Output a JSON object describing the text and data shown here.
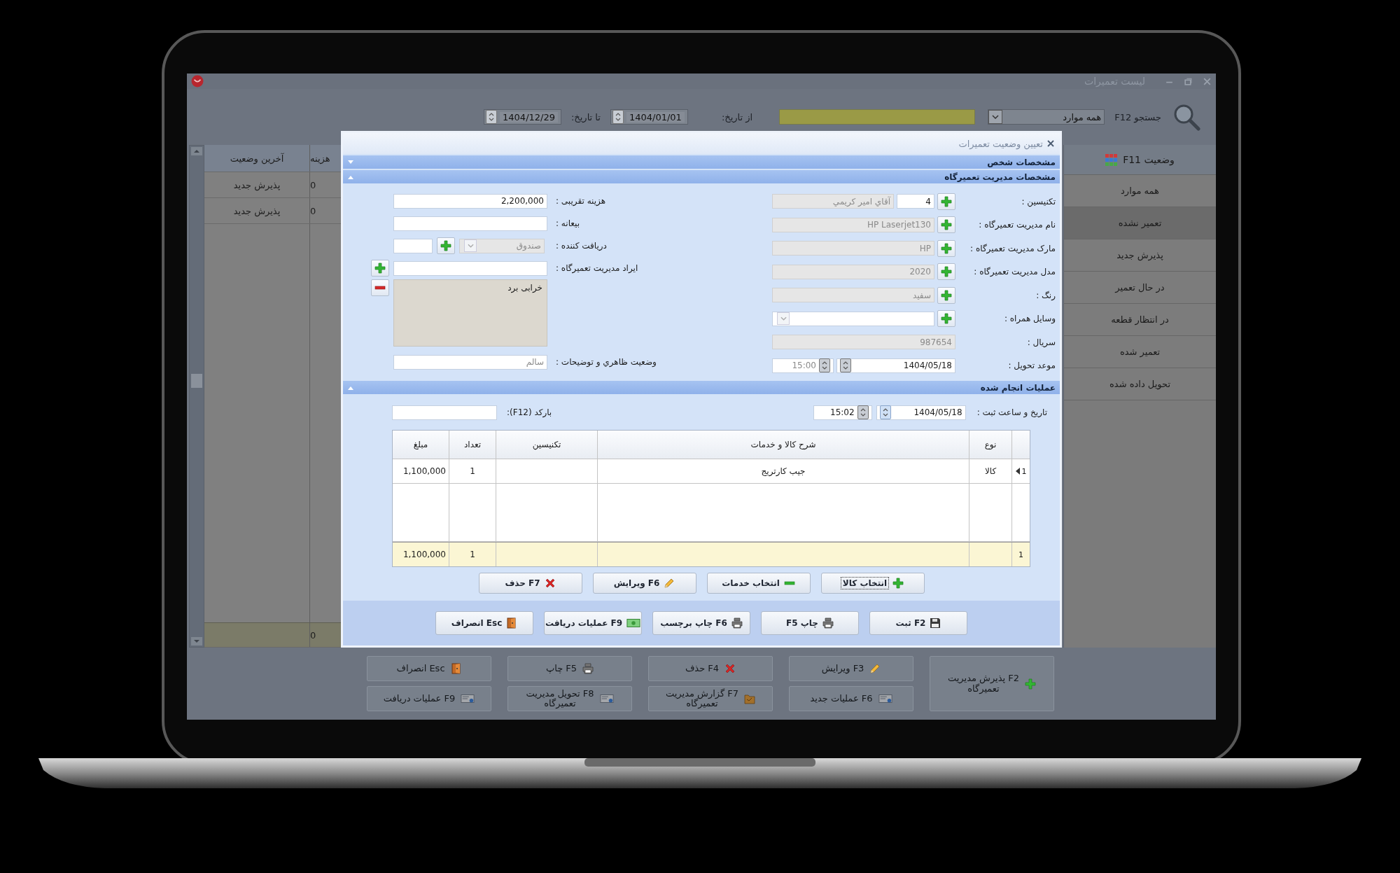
{
  "window": {
    "title": "لیست تعمیرات"
  },
  "toolbar": {
    "search_label": "جستجو F12",
    "filter": "همه موارد",
    "from_label": "از تاریخ:",
    "from_date": "1404/01/01",
    "to_label": "تا تاریخ:",
    "to_date": "1404/12/29"
  },
  "status_panel": {
    "title": "وضعیت F11",
    "items": [
      {
        "label": "همه موارد",
        "selected": false
      },
      {
        "label": "تعمیر نشده",
        "selected": true
      },
      {
        "label": "پذیرش جدید",
        "selected": false
      },
      {
        "label": "در حال تعمیر",
        "selected": false
      },
      {
        "label": "در انتظار قطعه",
        "selected": false
      },
      {
        "label": "تعمیر شده",
        "selected": false
      },
      {
        "label": "تحویل داده شده",
        "selected": false
      }
    ]
  },
  "table": {
    "columns": [
      "هزینه",
      "آخرین وضعیت"
    ],
    "rows": [
      [
        "0",
        "پذیرش جدید"
      ],
      [
        "0",
        "پذیرش جدید"
      ]
    ],
    "footer_total": "0"
  },
  "actions": [
    {
      "label": "F2 پذیرش مدیریت\nتعمیرگاه",
      "kind": "plus"
    },
    {
      "label": "F3 ویرایش",
      "kind": "pencil"
    },
    {
      "label": "F4 حذف",
      "kind": "cross"
    },
    {
      "label": "F5 چاپ",
      "kind": "printer"
    },
    {
      "label": "Esc انصراف",
      "kind": "door"
    },
    {
      "label": "F6 عملیات جدید",
      "kind": "card"
    },
    {
      "label": "F7 گزارش مدیریت\nتعمیرگاه",
      "kind": "folder"
    },
    {
      "label": "F8 تحویل مدیریت\nتعمیرگاه",
      "kind": "card"
    },
    {
      "label": "F9 عملیات دریافت",
      "kind": "card"
    }
  ],
  "dialog": {
    "title": "تعیین وضعیت تعمیرات",
    "person_section": {
      "title": "مشخصات شخص",
      "expanded": false
    },
    "device_section": {
      "title": "مشخصات مدیریت تعمیرگاه",
      "expanded": true,
      "right_fields": [
        {
          "label": "تکنیسین :",
          "kind": "code_name",
          "code": "4",
          "value": "آقاي امير  کريمي",
          "add": true,
          "disabled": true
        },
        {
          "label": "نام مدیریت تعمیرگاه :",
          "kind": "text",
          "value": "HP Laserjet130",
          "add": true,
          "disabled": true
        },
        {
          "label": "مارک مدیریت تعمیرگاه :",
          "kind": "text",
          "value": "HP",
          "add": true,
          "disabled": true
        },
        {
          "label": "مدل مدیریت تعمیرگاه :",
          "kind": "text",
          "value": "2020",
          "add": true,
          "disabled": true
        },
        {
          "label": "رنگ :",
          "kind": "text",
          "value": "سفید",
          "add": true,
          "disabled": true
        },
        {
          "label": "وسایل همراه :",
          "kind": "dropdown",
          "add": true,
          "disabled": false
        },
        {
          "label": "سریال :",
          "kind": "text",
          "value": "987654",
          "add": false,
          "disabled": true
        },
        {
          "label": "موعد تحویل :",
          "kind": "datetime",
          "date": "1404/05/18",
          "time": "15:00",
          "add": false,
          "disabled": false
        }
      ],
      "left_fields": [
        {
          "label": "هزینه تقریبی :",
          "kind": "text",
          "value": "2,200,000",
          "add": false
        },
        {
          "label": "بیعانه :",
          "kind": "text",
          "add": false
        },
        {
          "label": "دریافت کننده :",
          "kind": "receiver",
          "value": "صندوق",
          "add": true
        },
        {
          "label": "ایراد مدیریت تعمیرگاه :",
          "kind": "text",
          "add": true
        },
        {
          "kind": "notes",
          "value": "خرابی برد"
        },
        {
          "label": "وضعیت ظاهري و توضیحات :",
          "kind": "text",
          "value": "سالم",
          "add": false
        }
      ]
    },
    "operations_section": {
      "title": "عملیات انجام شده",
      "expanded": true,
      "date_label": "تاریخ و ساعت ثبت :",
      "date": "1404/05/18",
      "time": "15:02",
      "barcode_label": "بارکد (F12):",
      "columns": [
        "نوع",
        "شرح کالا و خدمات",
        "تکنیسین",
        "تعداد",
        "مبلغ"
      ],
      "rows": [
        {
          "number": "1",
          "current": true,
          "type": "کالا",
          "description": "جیب کارتریج",
          "quantity": "1",
          "amount": "1,100,000"
        }
      ],
      "totals": {
        "number": "1",
        "quantity": "1",
        "amount": "1,100,000"
      },
      "item_buttons": [
        {
          "label": "انتخاب کالا",
          "kind": "plus",
          "focused": true
        },
        {
          "label": "انتخاب خدمات",
          "kind": "minus",
          "focused": false
        },
        {
          "label": "F6 ویرایش",
          "kind": "pencil",
          "focused": false
        },
        {
          "label": "F7 حذف",
          "kind": "cross",
          "focused": false
        }
      ]
    },
    "footer_buttons": [
      {
        "label": "F2 ثبت",
        "kind": "save"
      },
      {
        "label": "چاپ F5",
        "kind": "printer"
      },
      {
        "label": "F6 چاپ برچسب",
        "kind": "printer"
      },
      {
        "label": "F9 عملیات دریافت",
        "kind": "banknote"
      },
      {
        "label": "Esc انصراف",
        "kind": "door"
      }
    ]
  }
}
